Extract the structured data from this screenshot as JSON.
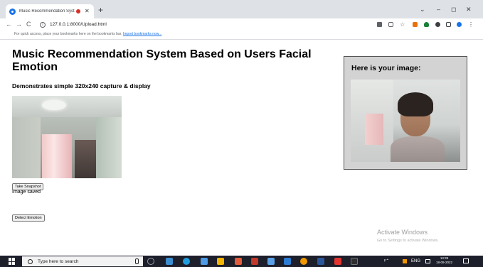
{
  "browser": {
    "tab_title": "Music Recommendation Syst",
    "tab_close": "✕",
    "new_tab": "+",
    "url": "127.0.0.1:8000/Upload.html",
    "bookmarks_prompt": "For quick access, place your bookmarks here on the bookmarks bar.",
    "bookmarks_link": "Import bookmarks now...",
    "nav": {
      "back": "←",
      "forward": "→",
      "reload": "C"
    },
    "window": {
      "collapse": "⌄",
      "minimize": "–",
      "maximize": "◻",
      "close": "✕"
    }
  },
  "page": {
    "title": "Music Recommendation System Based on Users Facial Emotion",
    "subtitle": "Demonstrates simple 320x240 capture & display",
    "take_snapshot_label": "Take Snapshot",
    "status": "Image saved",
    "detect_emotion_label": "Detect Emotion",
    "result_heading": "Here is your image:"
  },
  "os": {
    "watermark_title": "Activate Windows",
    "watermark_subtitle": "Go to Settings to activate Windows.",
    "search_placeholder": "Type here to search",
    "time": "13:39",
    "date": "18-09-2022",
    "tray_symbols": "ᵖ⌃",
    "language": "ENG"
  },
  "colors": {
    "accent": "#1a73e8",
    "taskbar": "#1d1f2b",
    "result_panel_bg": "#d3d3d3"
  },
  "icons": [
    "favicon-icon",
    "recording-dot-icon",
    "info-icon",
    "camera-icon",
    "share-icon",
    "star-icon",
    "extension-icon",
    "windows-start-icon",
    "search-icon",
    "microphone-icon"
  ]
}
